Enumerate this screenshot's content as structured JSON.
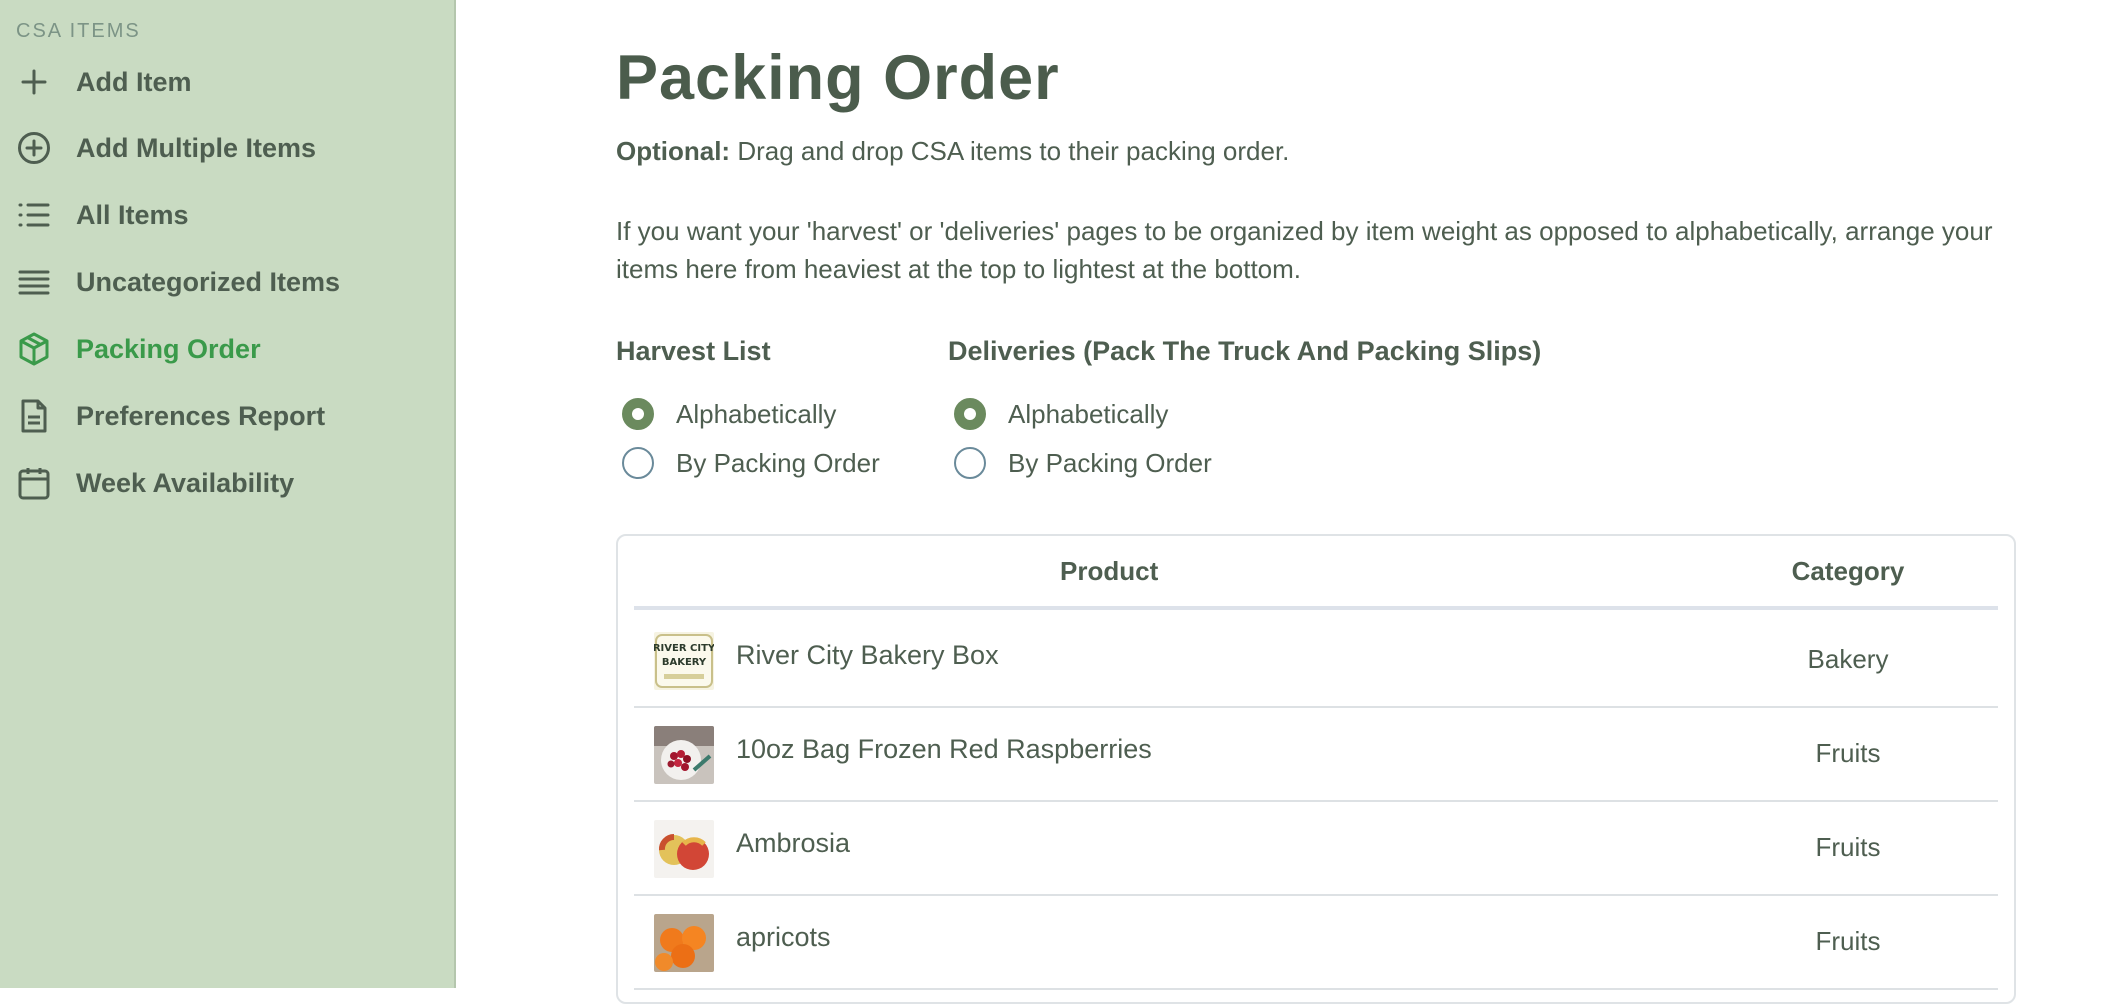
{
  "sidebar": {
    "heading": "CSA ITEMS",
    "items": [
      {
        "label": "Add Item",
        "icon": "plus-icon"
      },
      {
        "label": "Add Multiple Items",
        "icon": "plus-circle-icon"
      },
      {
        "label": "All Items",
        "icon": "list-icon"
      },
      {
        "label": "Uncategorized Items",
        "icon": "lines-icon"
      },
      {
        "label": "Packing Order",
        "icon": "box-icon",
        "active": true
      },
      {
        "label": "Preferences Report",
        "icon": "document-icon"
      },
      {
        "label": "Week Availability",
        "icon": "calendar-icon"
      }
    ]
  },
  "main": {
    "title": "Packing Order",
    "optional_bold": "Optional:",
    "optional_text": " Drag and drop CSA items to their packing order.",
    "intro": "If you want your 'harvest' or 'deliveries' pages to be organized by item weight as opposed to alphabetically, arrange your items here from heaviest at the top to lightest at the bottom.",
    "harvest": {
      "title": "Harvest List",
      "options": [
        "Alphabetically",
        "By Packing Order"
      ],
      "selected": "Alphabetically"
    },
    "deliveries": {
      "title": "Deliveries (Pack The Truck And Packing Slips)",
      "options": [
        "Alphabetically",
        "By Packing Order"
      ],
      "selected": "Alphabetically"
    },
    "table": {
      "columns": [
        "Product",
        "Category"
      ],
      "rows": [
        {
          "product": "River City Bakery Box",
          "category": "Bakery",
          "thumb_text": "RIVER CITY BAKERY"
        },
        {
          "product": "10oz Bag Frozen Red Raspberries",
          "category": "Fruits"
        },
        {
          "product": "Ambrosia",
          "category": "Fruits"
        },
        {
          "product": "apricots",
          "category": "Fruits"
        }
      ]
    }
  },
  "colors": {
    "sidebar_bg": "#c9dbc2",
    "active_nav": "#3a9a4a",
    "radio_checked": "#6b8a5e",
    "text": "#4e5e50"
  }
}
